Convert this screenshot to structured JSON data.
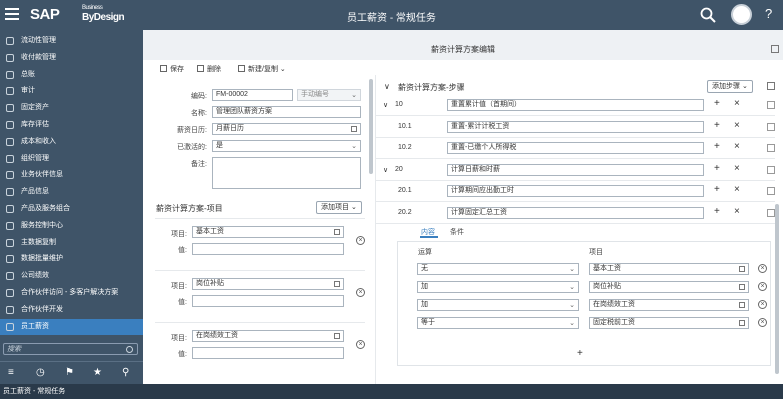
{
  "topbar": {
    "logo": "SAP",
    "logo_small": "Business",
    "logo_sub": "ByDesign",
    "title": "员工薪资 - 常规任务",
    "help": "?"
  },
  "sidebar": {
    "items": [
      {
        "label": "流动性管理",
        "icon": "liquidity-icon"
      },
      {
        "label": "收付款管理",
        "icon": "payment-icon"
      },
      {
        "label": "总账",
        "icon": "ledger-icon"
      },
      {
        "label": "审计",
        "icon": "audit-icon"
      },
      {
        "label": "固定资产",
        "icon": "asset-icon"
      },
      {
        "label": "库存评估",
        "icon": "inventory-icon"
      },
      {
        "label": "成本和收入",
        "icon": "cost-icon"
      },
      {
        "label": "组织管理",
        "icon": "org-icon"
      },
      {
        "label": "业务伙伴信息",
        "icon": "partner-icon"
      },
      {
        "label": "产品信息",
        "icon": "product-icon"
      },
      {
        "label": "产品及服务组合",
        "icon": "portfolio-icon"
      },
      {
        "label": "服务控制中心",
        "icon": "service-icon"
      },
      {
        "label": "主数据复制",
        "icon": "replicate-icon"
      },
      {
        "label": "数据批量维护",
        "icon": "mass-data-icon"
      },
      {
        "label": "公司绩效",
        "icon": "performance-icon"
      },
      {
        "label": "合作伙伴访问 - 多客户解决方案",
        "icon": "access-icon"
      },
      {
        "label": "合作伙伴开发",
        "icon": "dev-icon"
      },
      {
        "label": "员工薪资",
        "icon": "payroll-icon"
      }
    ],
    "search_placeholder": "搜索"
  },
  "header": {
    "title": "薪资计算方案编辑"
  },
  "toolbar": {
    "save": "保存",
    "delete": "删除",
    "new_copy": "新建/复制"
  },
  "form": {
    "code_label": "编码:",
    "code_value": "FM-00002",
    "code_mode": "手动编号",
    "name_label": "名称:",
    "name_value": "管理团队薪资方案",
    "calendar_label": "薪资日历:",
    "calendar_value": "月薪日历",
    "active_label": "已激活的:",
    "active_value": "是",
    "note_label": "备注:"
  },
  "items": {
    "title": "薪资计算方案-项目",
    "add_button": "添加项目",
    "item_label": "项目:",
    "value_label": "值:",
    "rows": [
      {
        "item": "基本工资"
      },
      {
        "item": "岗位补贴"
      },
      {
        "item": "在岗绩效工资"
      }
    ]
  },
  "steps": {
    "title": "薪资计算方案-步骤",
    "add_button": "添加步骤",
    "rows": [
      {
        "no": "10",
        "name": "重置累计值（首期间）"
      },
      {
        "no": "10.1",
        "name": "重置-累计计税工资"
      },
      {
        "no": "10.2",
        "name": "重置-已缴个人所得税"
      },
      {
        "no": "20",
        "name": "计算日薪和时薪"
      },
      {
        "no": "20.1",
        "name": "计算期间应出勤工时"
      },
      {
        "no": "20.2",
        "name": "计算固定汇总工资"
      }
    ],
    "tabs": {
      "content": "内容",
      "condition": "条件"
    },
    "grid": {
      "col_op": "运算",
      "col_item": "项目",
      "rows": [
        {
          "op": "无",
          "item": "基本工资"
        },
        {
          "op": "加",
          "item": "岗位补贴"
        },
        {
          "op": "加",
          "item": "在岗绩效工资"
        },
        {
          "op": "等于",
          "item": "固定税前工资"
        }
      ]
    }
  },
  "statusbar": {
    "text": "员工薪资 - 常规任务"
  }
}
